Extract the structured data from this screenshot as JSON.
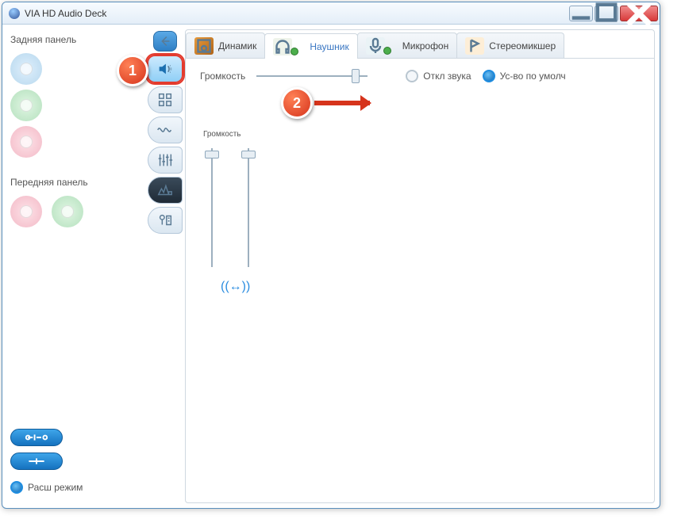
{
  "window": {
    "title": "VIA HD Audio Deck"
  },
  "leftcol": {
    "rear_label": "Задняя панель",
    "front_label": "Передняя панель",
    "adv_label": "Расш режим"
  },
  "tabs": {
    "speaker": "Динамик",
    "headphone": "Наушник",
    "mic": "Микрофон",
    "mixer": "Стереомикшер"
  },
  "content": {
    "volume_label": "Громкость",
    "mute_label": "Откл звука",
    "default_label": "Ус-во по умолч",
    "volume2_label": "Громкость",
    "master_slider_pct": 92,
    "ch_slider_pct": 2
  },
  "annotations": {
    "n1": "1",
    "n2": "2"
  }
}
